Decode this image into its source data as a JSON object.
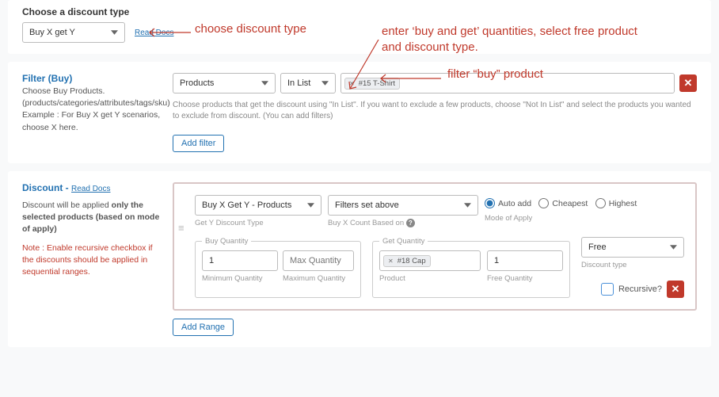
{
  "discount_type": {
    "heading": "Choose a discount type",
    "selected": "Buy X get Y",
    "docs_link": "Read Docs"
  },
  "filter": {
    "heading": "Filter (Buy)",
    "desc_line1": "Choose Buy Products.",
    "desc_line2": "(products/categories/attributes/tags/sku)",
    "desc_line3": "Example : For Buy X get Y scenarios, choose X here.",
    "field1": "Products",
    "field2": "In List",
    "token": "#15 T-Shirt",
    "hint": "Choose products that get the discount using \"In List\". If you want to exclude a few products, choose \"Not In List\" and select the products you wanted to exclude from discount. (You can add filters)",
    "add_filter": "Add filter"
  },
  "discount": {
    "heading": "Discount -",
    "docs_link": "Read Docs",
    "desc_prefix": "Discount will be applied ",
    "desc_strong": "only the selected products (based on mode of apply)",
    "note_prefix": "Note : ",
    "note_text": "Enable recursive checkbox if the discounts should be applied in sequential ranges.",
    "get_type": "Buy X Get Y - Products",
    "get_type_sub": "Get Y Discount Type",
    "count_based": "Filters set above",
    "count_based_sub": "Buy X Count Based on",
    "apply_auto": "Auto add",
    "apply_cheap": "Cheapest",
    "apply_high": "Highest",
    "apply_sub": "Mode of Apply",
    "buy_qty_label": "Buy Quantity",
    "buy_min_val": "1",
    "buy_min_sub": "Minimum Quantity",
    "buy_max_ph": "Max Quantity",
    "buy_max_sub": "Maximum Quantity",
    "get_qty_label": "Get Quantity",
    "get_token": "#18 Cap",
    "get_prod_sub": "Product",
    "free_qty_val": "1",
    "free_qty_sub": "Free Quantity",
    "disc_kind": "Free",
    "disc_kind_sub": "Discount type",
    "recursive_label": "Recursive?",
    "add_range": "Add Range"
  },
  "annotations": {
    "a1": "choose discount type",
    "a2": "filter “buy” product",
    "a3": "enter ‘buy and get’ quantities, select free product and discount type."
  }
}
